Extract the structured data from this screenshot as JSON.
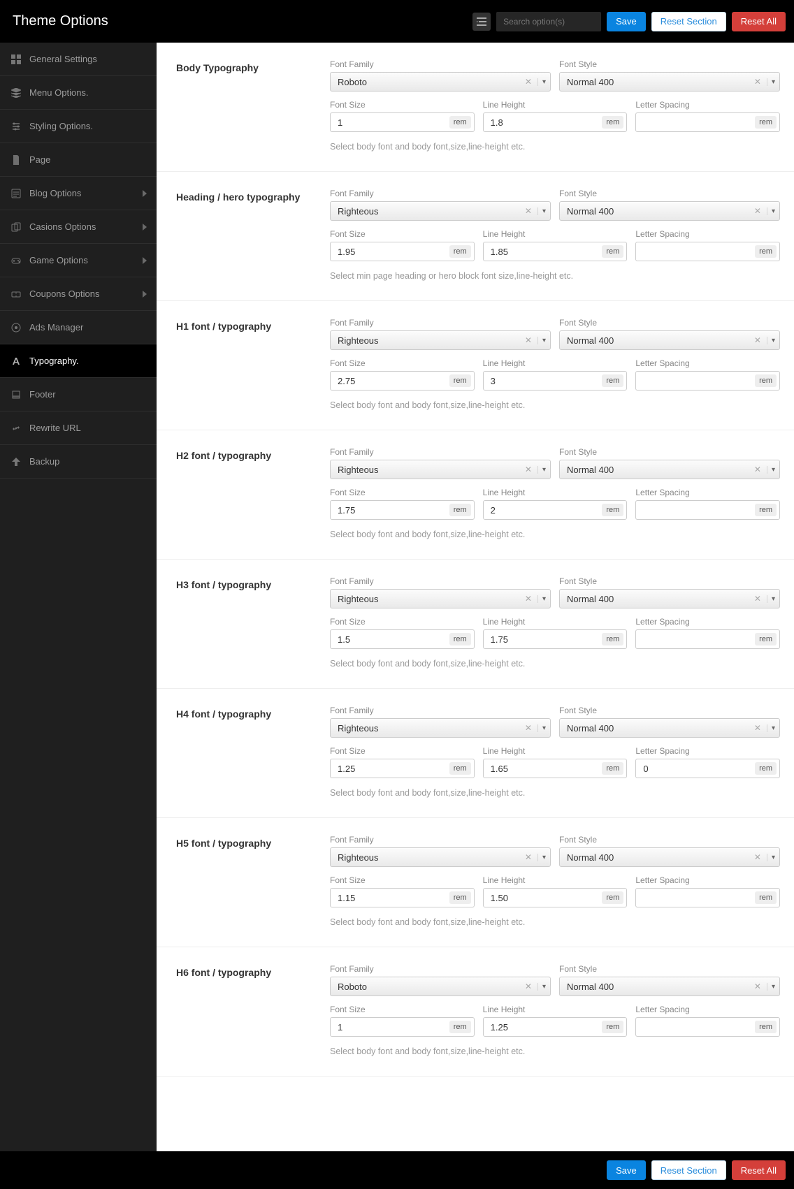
{
  "header": {
    "title": "Theme Options",
    "search_placeholder": "Search option(s)",
    "save": "Save",
    "reset_section": "Reset Section",
    "reset_all": "Reset All"
  },
  "sidebar": {
    "items": [
      {
        "label": "General Settings",
        "icon": "dashboard-icon",
        "sub": false
      },
      {
        "label": "Menu Options.",
        "icon": "layers-icon",
        "sub": false
      },
      {
        "label": "Styling Options.",
        "icon": "sliders-icon",
        "sub": false
      },
      {
        "label": "Page",
        "icon": "page-icon",
        "sub": false
      },
      {
        "label": "Blog Options",
        "icon": "blog-icon",
        "sub": true
      },
      {
        "label": "Casions Options",
        "icon": "cards-icon",
        "sub": true
      },
      {
        "label": "Game Options",
        "icon": "game-icon",
        "sub": true
      },
      {
        "label": "Coupons Options",
        "icon": "coupon-icon",
        "sub": true
      },
      {
        "label": "Ads Manager",
        "icon": "ads-icon",
        "sub": false
      },
      {
        "label": "Typography.",
        "icon": "typography-icon",
        "sub": false,
        "active": true
      },
      {
        "label": "Footer",
        "icon": "footer-icon",
        "sub": false
      },
      {
        "label": "Rewrite URL",
        "icon": "rewrite-icon",
        "sub": false
      },
      {
        "label": "Backup",
        "icon": "backup-icon",
        "sub": false
      }
    ]
  },
  "labels": {
    "font_family": "Font Family",
    "font_style": "Font Style",
    "font_size": "Font Size",
    "line_height": "Line Height",
    "letter_spacing": "Letter Spacing",
    "unit": "rem"
  },
  "sections": [
    {
      "title": "Body Typography",
      "font_family": "Roboto",
      "font_style": "Normal 400",
      "font_size": "1",
      "line_height": "1.8",
      "letter_spacing": "",
      "desc": "Select body font and body font,size,line-height etc."
    },
    {
      "title": "Heading / hero typography",
      "font_family": "Righteous",
      "font_style": "Normal 400",
      "font_size": "1.95",
      "line_height": "1.85",
      "letter_spacing": "",
      "desc": "Select min page heading or hero block font size,line-height etc."
    },
    {
      "title": "H1 font / typography",
      "font_family": "Righteous",
      "font_style": "Normal 400",
      "font_size": "2.75",
      "line_height": "3",
      "letter_spacing": "",
      "desc": "Select body font and body font,size,line-height etc."
    },
    {
      "title": "H2 font / typography",
      "font_family": "Righteous",
      "font_style": "Normal 400",
      "font_size": "1.75",
      "line_height": "2",
      "letter_spacing": "",
      "desc": "Select body font and body font,size,line-height etc."
    },
    {
      "title": "H3 font / typography",
      "font_family": "Righteous",
      "font_style": "Normal 400",
      "font_size": "1.5",
      "line_height": "1.75",
      "letter_spacing": "",
      "desc": "Select body font and body font,size,line-height etc."
    },
    {
      "title": "H4 font / typography",
      "font_family": "Righteous",
      "font_style": "Normal 400",
      "font_size": "1.25",
      "line_height": "1.65",
      "letter_spacing": "0",
      "desc": "Select body font and body font,size,line-height etc."
    },
    {
      "title": "H5 font / typography",
      "font_family": "Righteous",
      "font_style": "Normal 400",
      "font_size": "1.15",
      "line_height": "1.50",
      "letter_spacing": "",
      "desc": "Select body font and body font,size,line-height etc."
    },
    {
      "title": "H6 font / typography",
      "font_family": "Roboto",
      "font_style": "Normal 400",
      "font_size": "1",
      "line_height": "1.25",
      "letter_spacing": "",
      "desc": "Select body font and body font,size,line-height etc."
    }
  ],
  "footer": {
    "save": "Save",
    "reset_section": "Reset Section",
    "reset_all": "Reset All"
  }
}
